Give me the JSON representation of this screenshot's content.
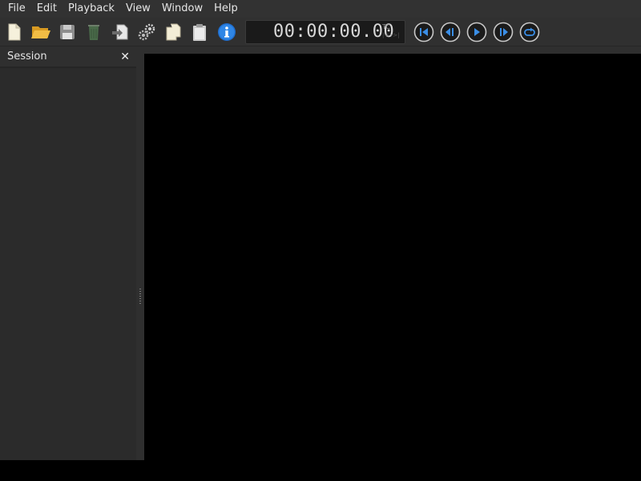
{
  "menubar": {
    "items": [
      "File",
      "Edit",
      "Playback",
      "View",
      "Window",
      "Help"
    ]
  },
  "toolbar": {
    "buttons": [
      {
        "name": "new-file",
        "icon": "new-file-icon"
      },
      {
        "name": "open-folder",
        "icon": "folder-open-icon"
      },
      {
        "name": "save",
        "icon": "save-icon"
      },
      {
        "name": "trash",
        "icon": "trash-icon"
      },
      {
        "name": "export",
        "icon": "export-icon"
      },
      {
        "name": "settings",
        "icon": "gears-icon"
      },
      {
        "name": "copy",
        "icon": "copy-icon"
      },
      {
        "name": "paste",
        "icon": "clipboard-icon"
      },
      {
        "name": "info",
        "icon": "info-icon"
      }
    ],
    "transport": [
      {
        "name": "go-to-start",
        "icon": "skip-to-start-icon"
      },
      {
        "name": "step-back",
        "icon": "step-back-icon"
      },
      {
        "name": "play",
        "icon": "play-icon"
      },
      {
        "name": "step-forward",
        "icon": "step-forward-icon"
      },
      {
        "name": "loop",
        "icon": "loop-icon"
      }
    ]
  },
  "timecode": {
    "value": "00:00:00.00",
    "mode": "TC",
    "arrows": "|<-->|"
  },
  "session_panel": {
    "title": "Session",
    "close_label": "✕"
  },
  "colors": {
    "accent": "#3a8ee6",
    "menubar_bg": "#323232",
    "panel_bg": "#2b2b2b",
    "viewer_bg": "#000000"
  }
}
